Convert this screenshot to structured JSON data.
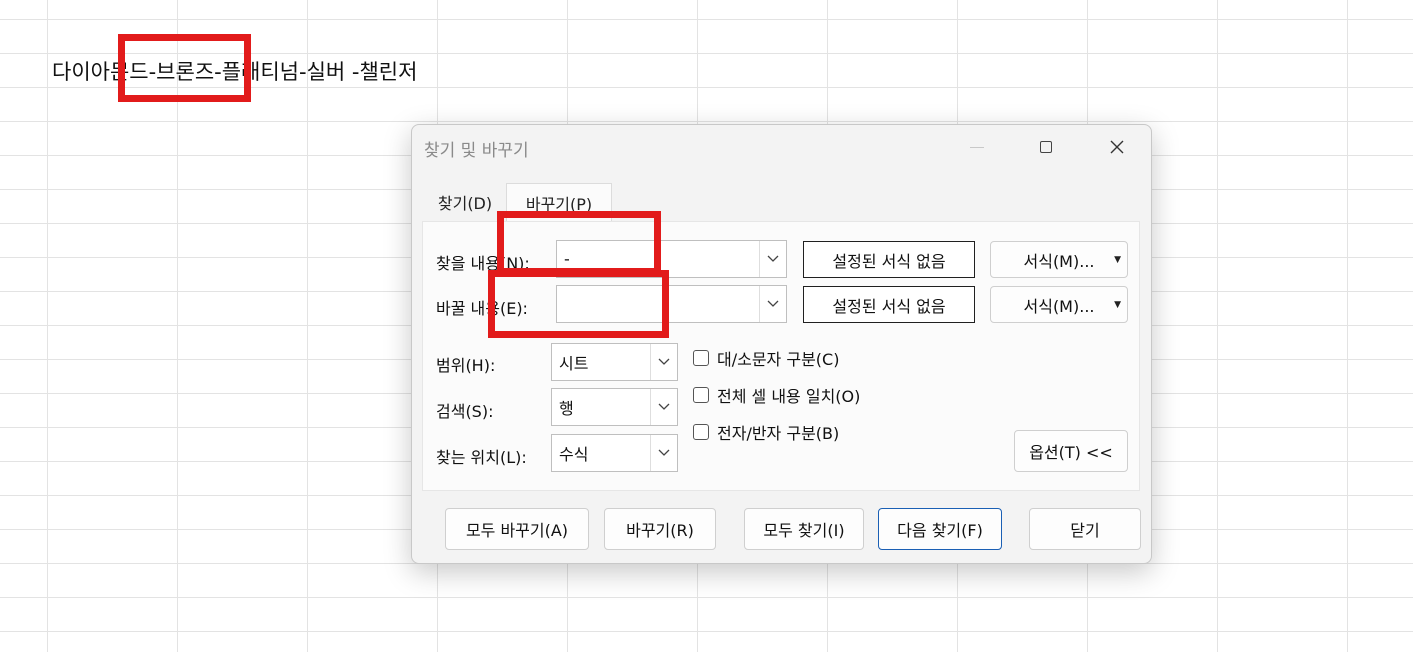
{
  "sheet": {
    "cell_text": "다이아몬드-브론즈-플래티넘-실버 -챌린저"
  },
  "dialog": {
    "title": "찾기 및 바꾸기",
    "tabs": [
      {
        "label": "찾기(D)",
        "active": false
      },
      {
        "label": "바꾸기(P)",
        "active": true
      }
    ],
    "find": {
      "label": "찾을 내용(N):",
      "value": "-",
      "format_status": "설정된 서식 없음",
      "format_button": "서식(M)..."
    },
    "replace": {
      "label": "바꿀 내용(E):",
      "value": "",
      "format_status": "설정된 서식 없음",
      "format_button": "서식(M)..."
    },
    "scope": {
      "label": "범위(H):",
      "value": "시트"
    },
    "search": {
      "label": "검색(S):",
      "value": "행"
    },
    "look_in": {
      "label": "찾는 위치(L):",
      "value": "수식"
    },
    "options": [
      {
        "label": "대/소문자 구분(C)",
        "checked": false
      },
      {
        "label": "전체 셀 내용 일치(O)",
        "checked": false
      },
      {
        "label": "전자/반자 구분(B)",
        "checked": false
      }
    ],
    "options_toggle": "옵션(T) <<",
    "buttons": {
      "replace_all": "모두 바꾸기(A)",
      "replace": "바꾸기(R)",
      "find_all": "모두 찾기(I)",
      "find_next": "다음 찾기(F)",
      "close": "닫기"
    }
  },
  "icons": {
    "minimize": "minimize-icon",
    "maximize": "maximize-icon",
    "close": "close-icon",
    "dropdown": "chevron-down-icon"
  },
  "colors": {
    "highlight": "#e21b1b",
    "primary_border": "#1a5fb4",
    "dialog_bg": "#f3f3f3"
  }
}
